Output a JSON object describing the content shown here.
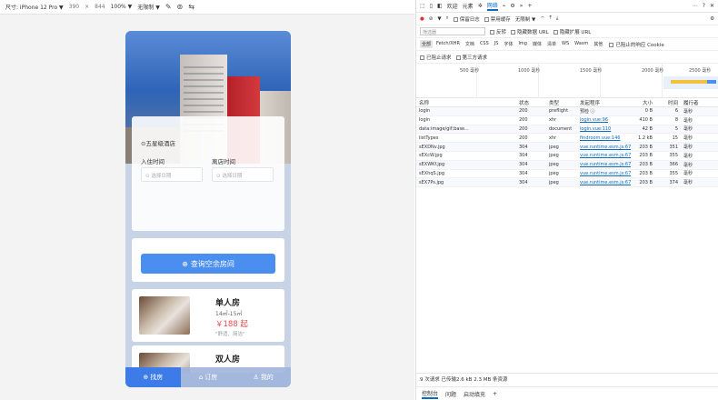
{
  "device_toolbar": {
    "device": "尺寸: iPhone 12 Pro ▼",
    "width": "390",
    "x": "×",
    "height": "844",
    "zoom": "100% ▼",
    "throttle": "无限制 ▼"
  },
  "app": {
    "location": "⊙五星级酒店",
    "checkin_label": "入住时间",
    "checkout_label": "离店时间",
    "checkin_placeholder": "⊙ 选择日期",
    "checkout_placeholder": "⊙ 选择日期",
    "search_button": "查询空余房间",
    "rooms": [
      {
        "name": "单人房",
        "size": "14㎡-15㎡",
        "price": "￥188 起",
        "desc": "\"舒适、简洁\""
      },
      {
        "name": "双人房"
      }
    ],
    "tabs": [
      {
        "label": "找房",
        "icon": "search-icon"
      },
      {
        "label": "订房",
        "icon": "home-icon"
      },
      {
        "label": "我的",
        "icon": "user-icon"
      }
    ],
    "colors": {
      "primary": "#4a8ff0",
      "price": "#e64a4a",
      "tab_active": "#3d7be8"
    }
  },
  "devtools": {
    "tabs": [
      "欢迎",
      "元素",
      "网络"
    ],
    "active_tab": "网络",
    "toolbar": {
      "preserve_log": "保留日志",
      "disable_cache": "禁用缓存",
      "throttle": "无限制 ▼"
    },
    "filter_placeholder": "筛选器",
    "invert": "反转",
    "hide_data_urls": "隐藏数据 URL",
    "hide_extension_urls": "隐藏扩展 URL",
    "types": [
      "全部",
      "Fetch/XHR",
      "文档",
      "CSS",
      "JS",
      "字体",
      "Img",
      "媒体",
      "清单",
      "WS",
      "Wasm",
      "其他"
    ],
    "blocked_cookies": "已阻止的响应 Cookie",
    "blocked_requests": "已阻止请求",
    "third_party": "第三方请求",
    "timeline_labels": [
      "500 毫秒",
      "1000 毫秒",
      "1500 毫秒",
      "2000 毫秒",
      "2500 毫秒"
    ],
    "columns": [
      "名称",
      "状态",
      "类型",
      "发起程序",
      "大小",
      "时间",
      "履行者"
    ],
    "rows": [
      {
        "name": "login",
        "status": "200",
        "type": "preflight",
        "initiator": "预检 ⓘ",
        "size": "0 B",
        "time": "6",
        "unit": "毫秒",
        "link": false
      },
      {
        "name": "login",
        "status": "200",
        "type": "xhr",
        "initiator": "login.vue:96",
        "size": "410 B",
        "time": "8",
        "unit": "毫秒",
        "link": true
      },
      {
        "name": "data:image/gif;base...",
        "status": "200",
        "type": "document",
        "initiator": "login.vue:110",
        "size": "42 B",
        "time": "5",
        "unit": "毫秒",
        "link": true
      },
      {
        "name": "listTypes",
        "status": "200",
        "type": "xhr",
        "initiator": "findroom.vue:146",
        "size": "1.2 kB",
        "time": "15",
        "unit": "毫秒",
        "link": true
      },
      {
        "name": "sEXDNv.jpg",
        "status": "304",
        "type": "jpeg",
        "initiator": "vue.runtime.esm.js:67",
        "size": "203 B",
        "time": "351",
        "unit": "毫秒",
        "link": true
      },
      {
        "name": "sEXcW.jpg",
        "status": "304",
        "type": "jpeg",
        "initiator": "vue.runtime.esm.js:67",
        "size": "203 B",
        "time": "355",
        "unit": "毫秒",
        "link": true
      },
      {
        "name": "sEXWKf.jpg",
        "status": "304",
        "type": "jpeg",
        "initiator": "vue.runtime.esm.js:67",
        "size": "203 B",
        "time": "366",
        "unit": "毫秒",
        "link": true
      },
      {
        "name": "sEXhqS.jpg",
        "status": "304",
        "type": "jpeg",
        "initiator": "vue.runtime.esm.js:67",
        "size": "203 B",
        "time": "355",
        "unit": "毫秒",
        "link": true
      },
      {
        "name": "sEX7Ps.jpg",
        "status": "304",
        "type": "jpeg",
        "initiator": "vue.runtime.esm.js:67",
        "size": "203 B",
        "time": "374",
        "unit": "毫秒",
        "link": true
      }
    ],
    "status_bar": "9 次请求  已传输2.6 kB  2.3 MB 条资源",
    "drawer_tabs": [
      "控制台",
      "问题",
      "启动填充"
    ]
  }
}
